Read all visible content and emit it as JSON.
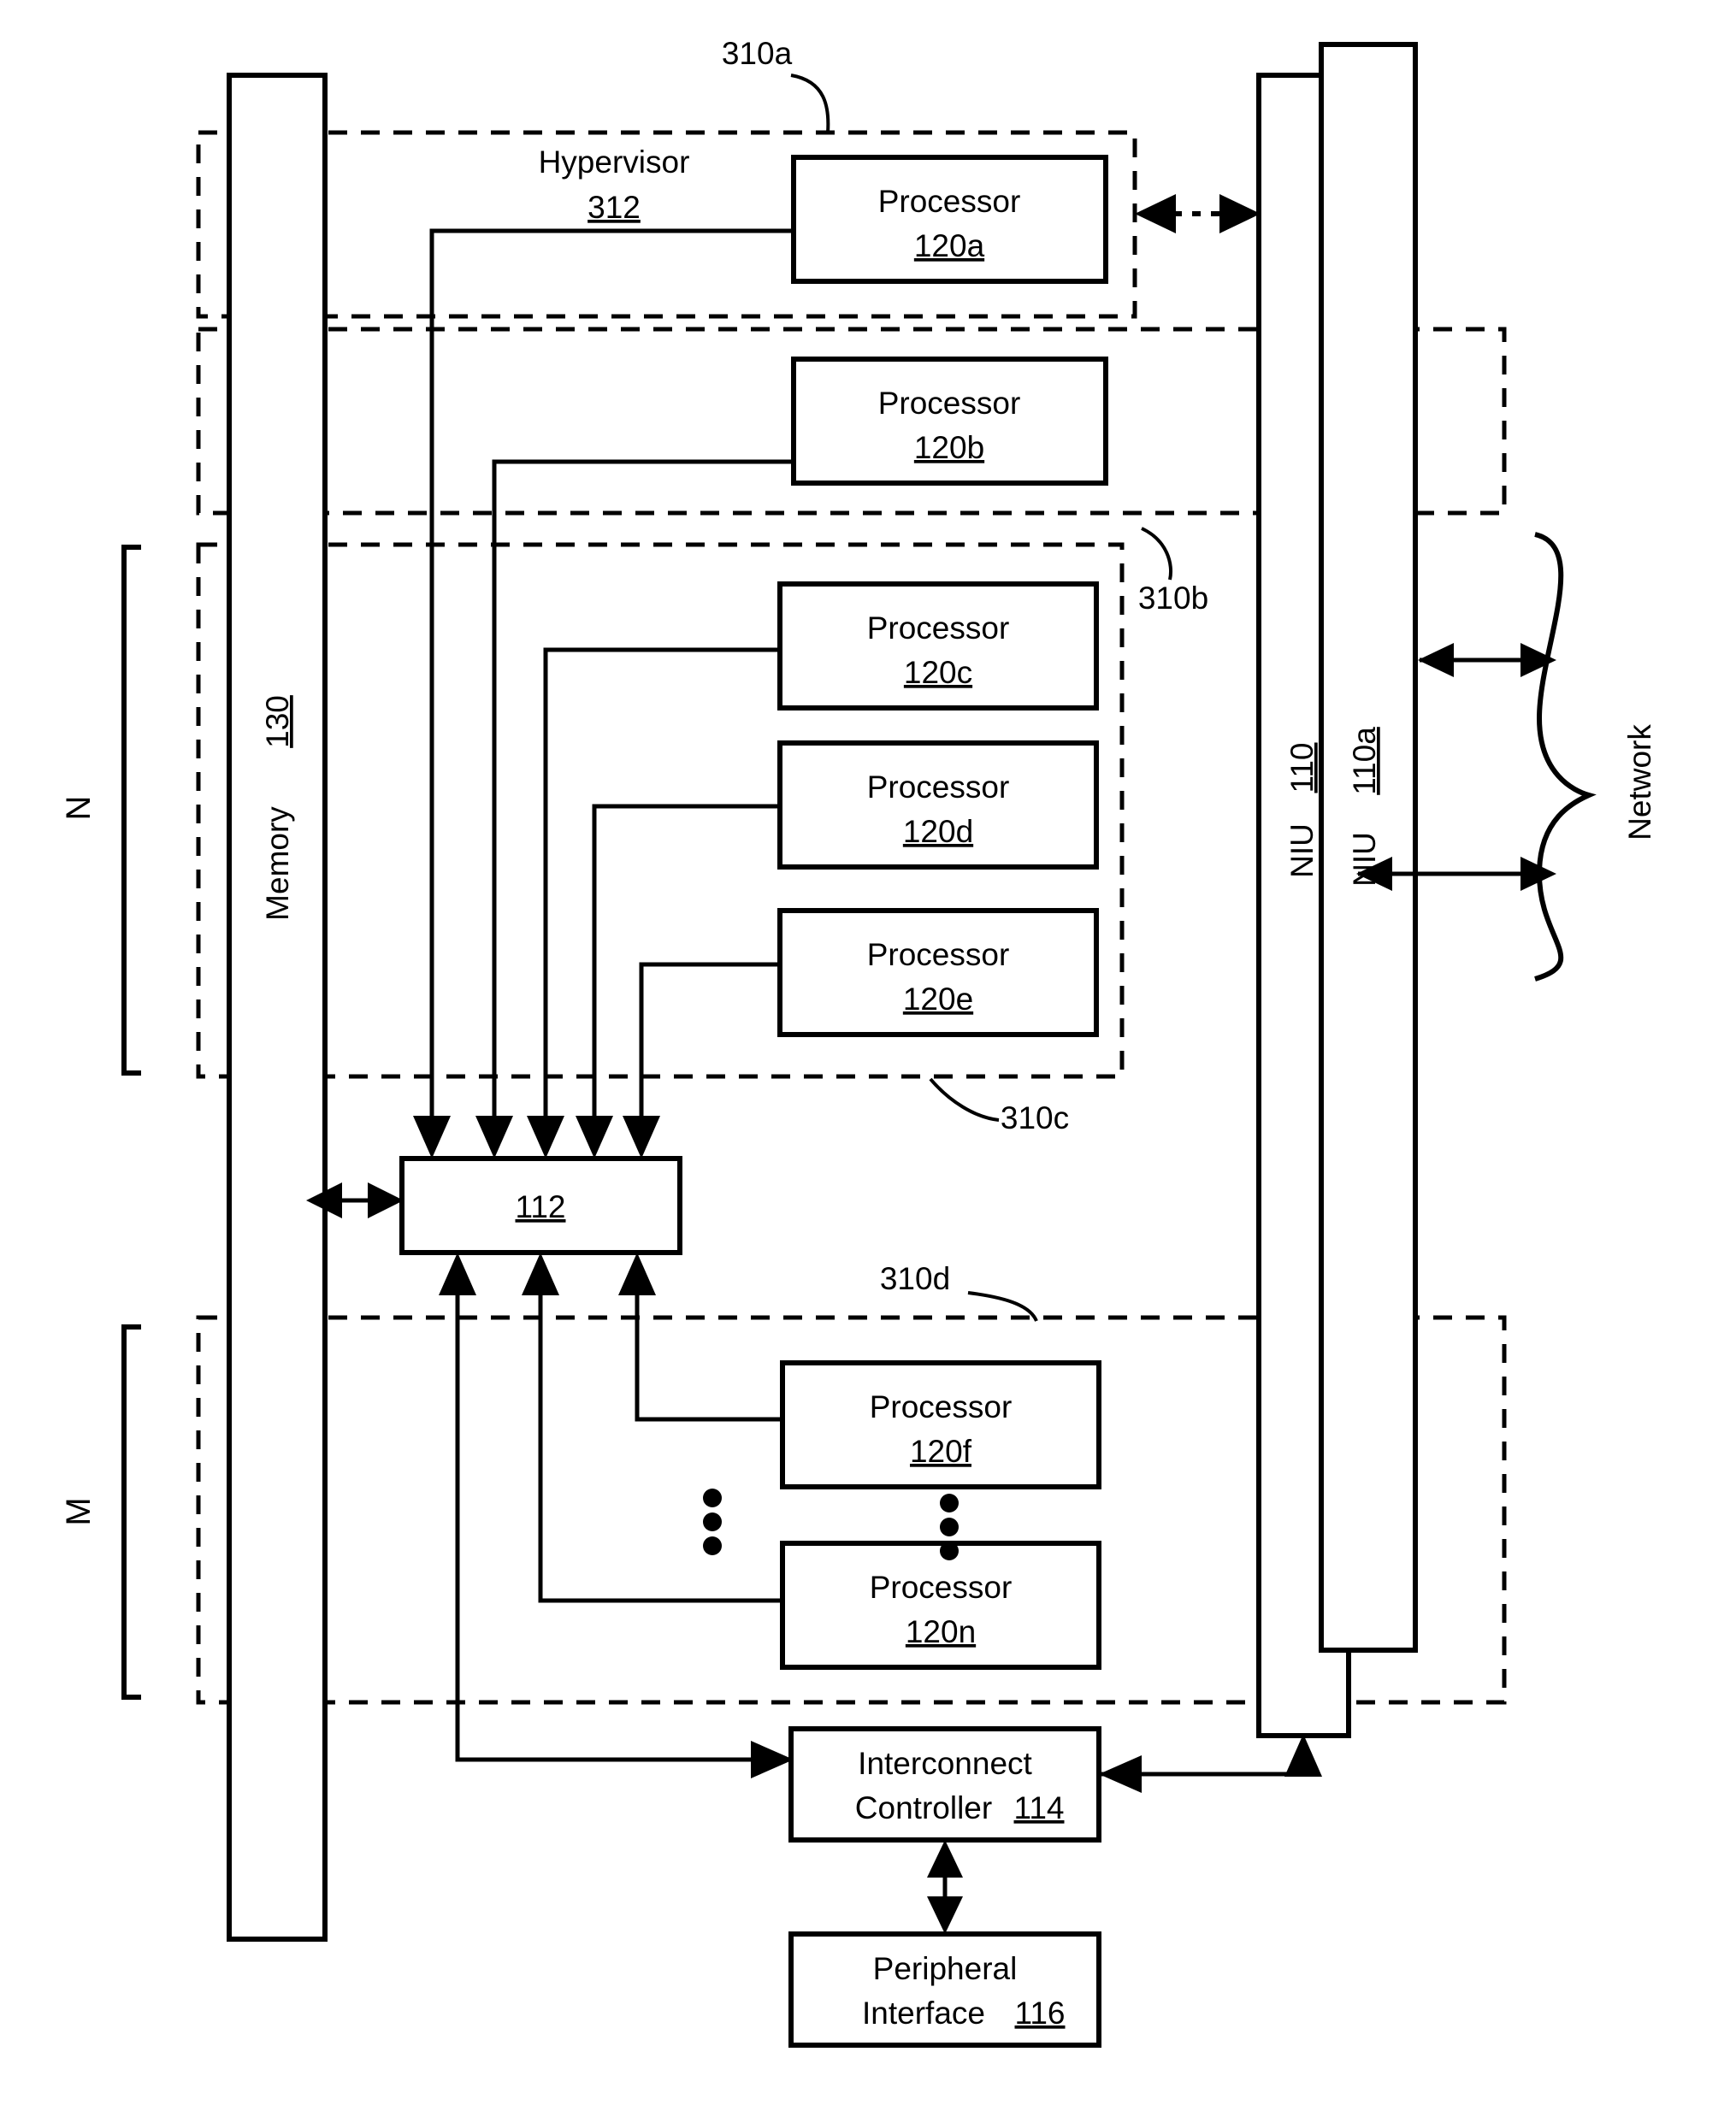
{
  "figure": {
    "type": "patent-block-diagram",
    "background": "#ffffff",
    "line_color": "#000000"
  },
  "groups": {
    "hypervisor_label": "Hypervisor",
    "hypervisor_ref": "312",
    "partitions": [
      {
        "id": "310a",
        "label": "310a"
      },
      {
        "id": "310b",
        "label": "310b"
      },
      {
        "id": "310c",
        "label": "310c"
      },
      {
        "id": "310d",
        "label": "310d"
      }
    ]
  },
  "brackets": [
    {
      "name": "n-bracket",
      "label": "N"
    },
    {
      "name": "m-bracket",
      "label": "M"
    }
  ],
  "memory": {
    "label": "Memory",
    "ref": "130"
  },
  "niu": [
    {
      "name": "niu-110",
      "label": "NIU",
      "ref": "110"
    },
    {
      "name": "niu-110a",
      "label": "NIU",
      "ref": "110a"
    }
  ],
  "network": {
    "label": "Network"
  },
  "processors": [
    {
      "id": "120a",
      "label": "Processor",
      "ref": "120a"
    },
    {
      "id": "120b",
      "label": "Processor",
      "ref": "120b"
    },
    {
      "id": "120c",
      "label": "Processor",
      "ref": "120c"
    },
    {
      "id": "120d",
      "label": "Processor",
      "ref": "120d"
    },
    {
      "id": "120e",
      "label": "Processor",
      "ref": "120e"
    },
    {
      "id": "120f",
      "label": "Processor",
      "ref": "120f"
    },
    {
      "id": "120n",
      "label": "Processor",
      "ref": "120n"
    }
  ],
  "blocks": {
    "interconnect_112": {
      "ref": "112"
    },
    "interconnect_controller": {
      "label_line1": "Interconnect",
      "label_line2": "Controller",
      "ref": "114"
    },
    "peripheral_interface": {
      "label_line1": "Peripheral",
      "label_line2": "Interface",
      "ref": "116"
    }
  },
  "ellipsis": {
    "glyph": "•",
    "count": 3
  }
}
